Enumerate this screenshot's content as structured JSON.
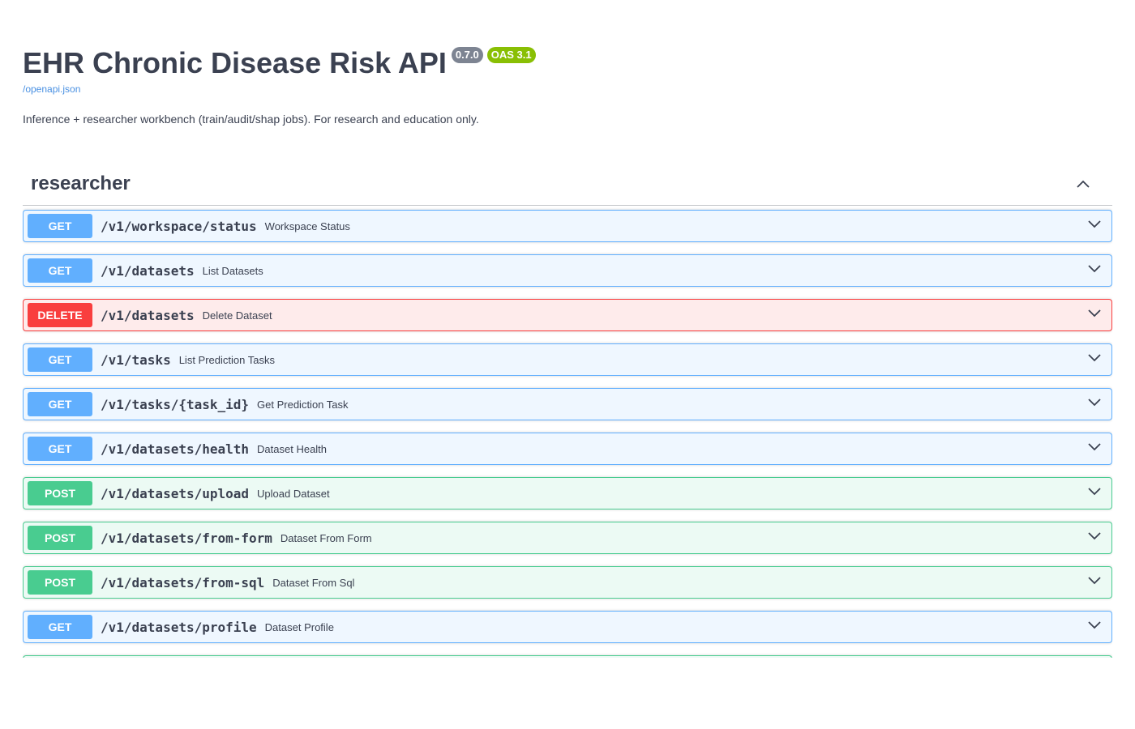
{
  "info": {
    "title": "EHR Chronic Disease Risk API",
    "version_badge": "0.7.0",
    "oas_badge": "OAS 3.1",
    "spec_link": "/openapi.json",
    "description": "Inference + researcher workbench (train/audit/shap jobs). For research and education only."
  },
  "tag": {
    "name": "researcher",
    "collapse_icon": "chevron-up-icon"
  },
  "operations": [
    {
      "method": "GET",
      "path": "/v1/workspace/status",
      "summary": "Workspace Status"
    },
    {
      "method": "GET",
      "path": "/v1/datasets",
      "summary": "List Datasets"
    },
    {
      "method": "DELETE",
      "path": "/v1/datasets",
      "summary": "Delete Dataset"
    },
    {
      "method": "GET",
      "path": "/v1/tasks",
      "summary": "List Prediction Tasks"
    },
    {
      "method": "GET",
      "path": "/v1/tasks/{task_id}",
      "summary": "Get Prediction Task"
    },
    {
      "method": "GET",
      "path": "/v1/datasets/health",
      "summary": "Dataset Health"
    },
    {
      "method": "POST",
      "path": "/v1/datasets/upload",
      "summary": "Upload Dataset"
    },
    {
      "method": "POST",
      "path": "/v1/datasets/from-form",
      "summary": "Dataset From Form"
    },
    {
      "method": "POST",
      "path": "/v1/datasets/from-sql",
      "summary": "Dataset From Sql"
    },
    {
      "method": "GET",
      "path": "/v1/datasets/profile",
      "summary": "Dataset Profile"
    },
    {
      "method": "POST",
      "path": "",
      "summary": ""
    }
  ],
  "colors": {
    "get": "#61affe",
    "post": "#49cc90",
    "delete": "#f93e3e",
    "version_badge": "#7d8492",
    "oas_badge": "#89bf04",
    "link": "#4990e2",
    "text": "#3b4151"
  }
}
